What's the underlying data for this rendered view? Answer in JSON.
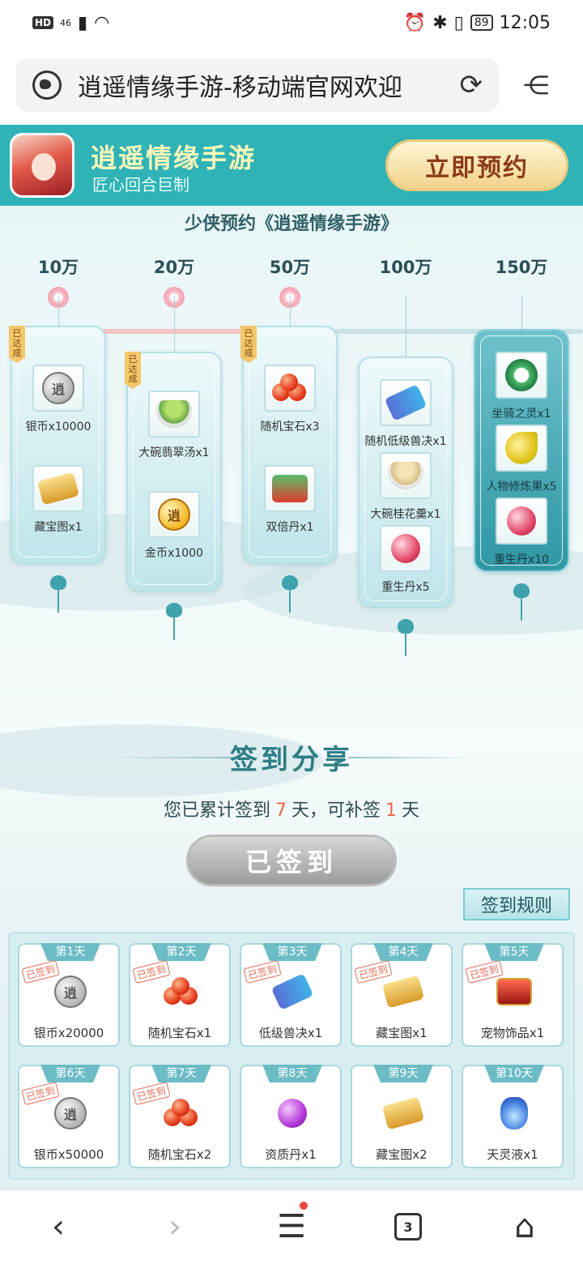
{
  "status_bar": {
    "hd": "HD",
    "network": "46",
    "battery": "89",
    "time": "12:05"
  },
  "browser": {
    "page_title": "逍遥情缘手游-移动端官网欢迎"
  },
  "header": {
    "app_name": "逍遥情缘手游",
    "slogan": "匠心回合巨制",
    "reserve_button": "立即预约"
  },
  "reservation": {
    "title": "少侠预约《逍遥情缘手游》",
    "progress": 0.55,
    "milestones": [
      {
        "label": "10万",
        "achieved": true,
        "badge": "已达成",
        "rewards": [
          {
            "icon": "silver-coin",
            "name": "银币x10000"
          },
          {
            "icon": "treasure-map",
            "name": "藏宝图x1"
          }
        ]
      },
      {
        "label": "20万",
        "achieved": true,
        "badge": "已达成",
        "rewards": [
          {
            "icon": "jade-soup-bowl",
            "name": "大碗翡翠汤x1"
          },
          {
            "icon": "gold-coin",
            "name": "金币x1000"
          }
        ]
      },
      {
        "label": "50万",
        "achieved": true,
        "badge": "已达成",
        "rewards": [
          {
            "icon": "gems",
            "name": "随机宝石x3"
          },
          {
            "icon": "double-pill-chest",
            "name": "双倍丹x1"
          }
        ]
      },
      {
        "label": "100万",
        "achieved": false,
        "rewards": [
          {
            "icon": "beast-skill-scroll",
            "name": "随机低级兽决x1"
          },
          {
            "icon": "osmanthus-soup-bowl",
            "name": "大碗桂花羹x1"
          },
          {
            "icon": "rebirth-pill",
            "name": "重生丹x5"
          }
        ]
      },
      {
        "label": "150万",
        "achieved": false,
        "rewards": [
          {
            "icon": "mount-spirit",
            "name": "坐骑之灵x1"
          },
          {
            "icon": "cultivation-fruit",
            "name": "人物修炼果x5"
          },
          {
            "icon": "rebirth-pill",
            "name": "重生丹x10"
          }
        ]
      }
    ]
  },
  "signin": {
    "title": "签到分享",
    "summary_prefix": "您已累计签到",
    "days_signed": "7",
    "summary_mid": "天，可补签",
    "makeup_days": "1",
    "summary_suffix": "天",
    "signed_button": "已签到",
    "rules_button": "签到规则",
    "signed_stamp": "已签到",
    "days": [
      {
        "tag": "第1天",
        "icon": "silver-coin",
        "reward": "银币x20000",
        "signed": true
      },
      {
        "tag": "第2天",
        "icon": "gems",
        "reward": "随机宝石x1",
        "signed": true
      },
      {
        "tag": "第3天",
        "icon": "beast-skill-scroll",
        "reward": "低级兽决x1",
        "signed": true
      },
      {
        "tag": "第4天",
        "icon": "treasure-map",
        "reward": "藏宝图x1",
        "signed": true
      },
      {
        "tag": "第5天",
        "icon": "pet-accessory-chest",
        "reward": "宠物饰品x1",
        "signed": true
      },
      {
        "tag": "第6天",
        "icon": "silver-coin",
        "reward": "银币x50000",
        "signed": true
      },
      {
        "tag": "第7天",
        "icon": "gems",
        "reward": "随机宝石x2",
        "signed": true
      },
      {
        "tag": "第8天",
        "icon": "aptitude-pill",
        "reward": "资质丹x1",
        "signed": false
      },
      {
        "tag": "第9天",
        "icon": "treasure-map",
        "reward": "藏宝图x2",
        "signed": false
      },
      {
        "tag": "第10天",
        "icon": "heaven-spirit-liquid",
        "reward": "天灵液x1",
        "signed": false
      }
    ]
  },
  "bottom_nav": {
    "tabs_count": "3"
  }
}
